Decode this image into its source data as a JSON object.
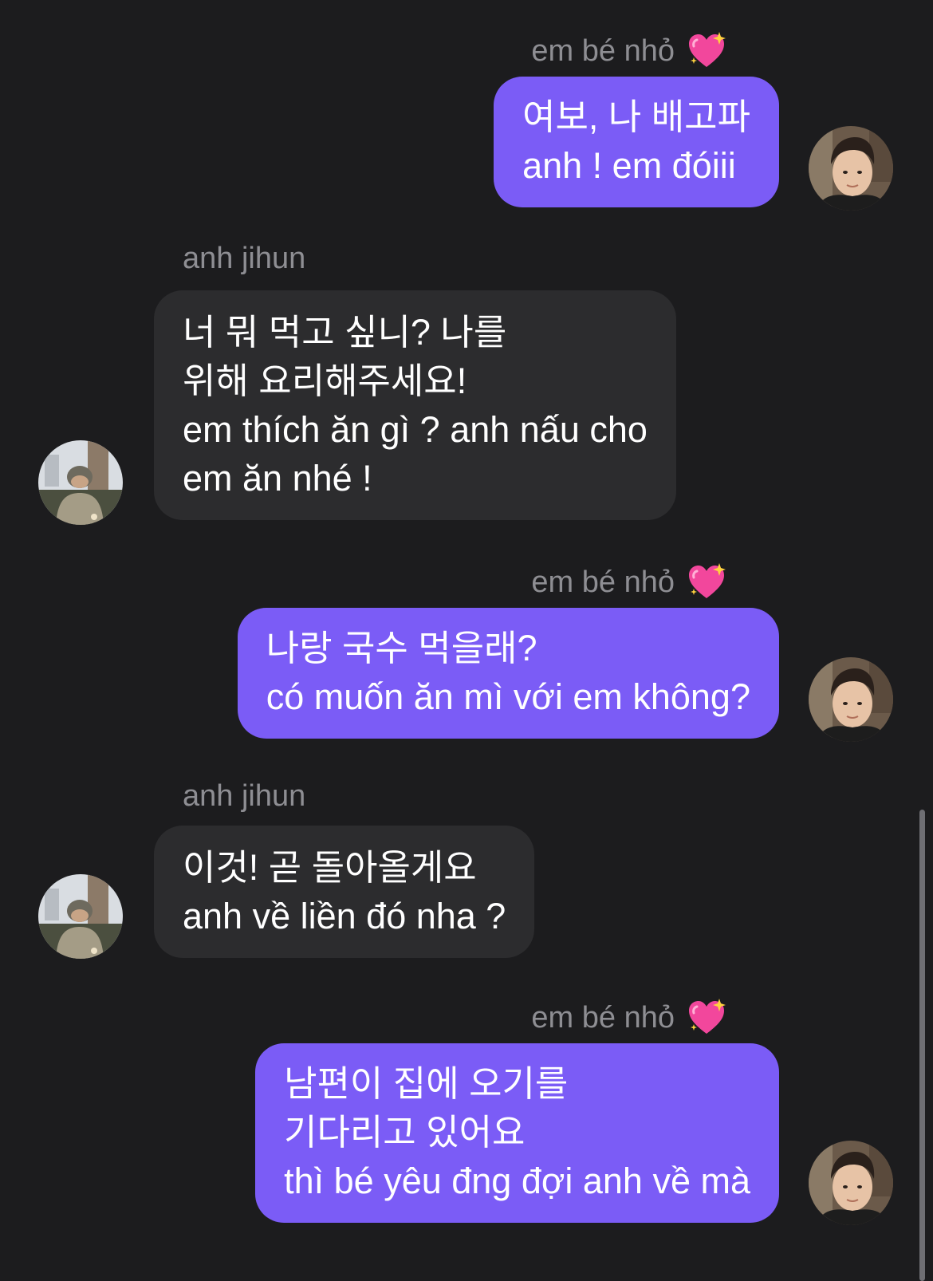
{
  "conversation": {
    "messages": [
      {
        "sender": "em bé nhỏ",
        "direction": "outgoing",
        "text": "여보, 나 배고파\nanh ! em đóiii"
      },
      {
        "sender": "anh jihun",
        "direction": "incoming",
        "text": "너 뭐 먹고 싶니? 나를\n위해 요리해주세요!\nem thích ăn gì ? anh nấu cho\nem ăn nhé !"
      },
      {
        "sender": "em bé nhỏ",
        "direction": "outgoing",
        "text": "나랑 국수 먹을래?\ncó muốn ăn mì với em không?"
      },
      {
        "sender": "anh jihun",
        "direction": "incoming",
        "text": "이것! 곧 돌아올게요\nanh về liền đó nha ?"
      },
      {
        "sender": "em bé nhỏ",
        "direction": "outgoing",
        "text": "남편이 집에 오기를\n기다리고 있어요\nthì bé yêu đng đợi anh về mà"
      }
    ]
  },
  "icons": {
    "sender_badge": "sparkling-heart-icon",
    "outgoing_avatar": "avatar-em-be-nho",
    "incoming_avatar": "avatar-anh-jihun"
  },
  "colors": {
    "background": "#1c1c1e",
    "outgoing_bubble": "#7b5cf6",
    "incoming_bubble": "#2c2c2e",
    "sender_name": "#8e8e93",
    "message_text": "#ffffff"
  }
}
